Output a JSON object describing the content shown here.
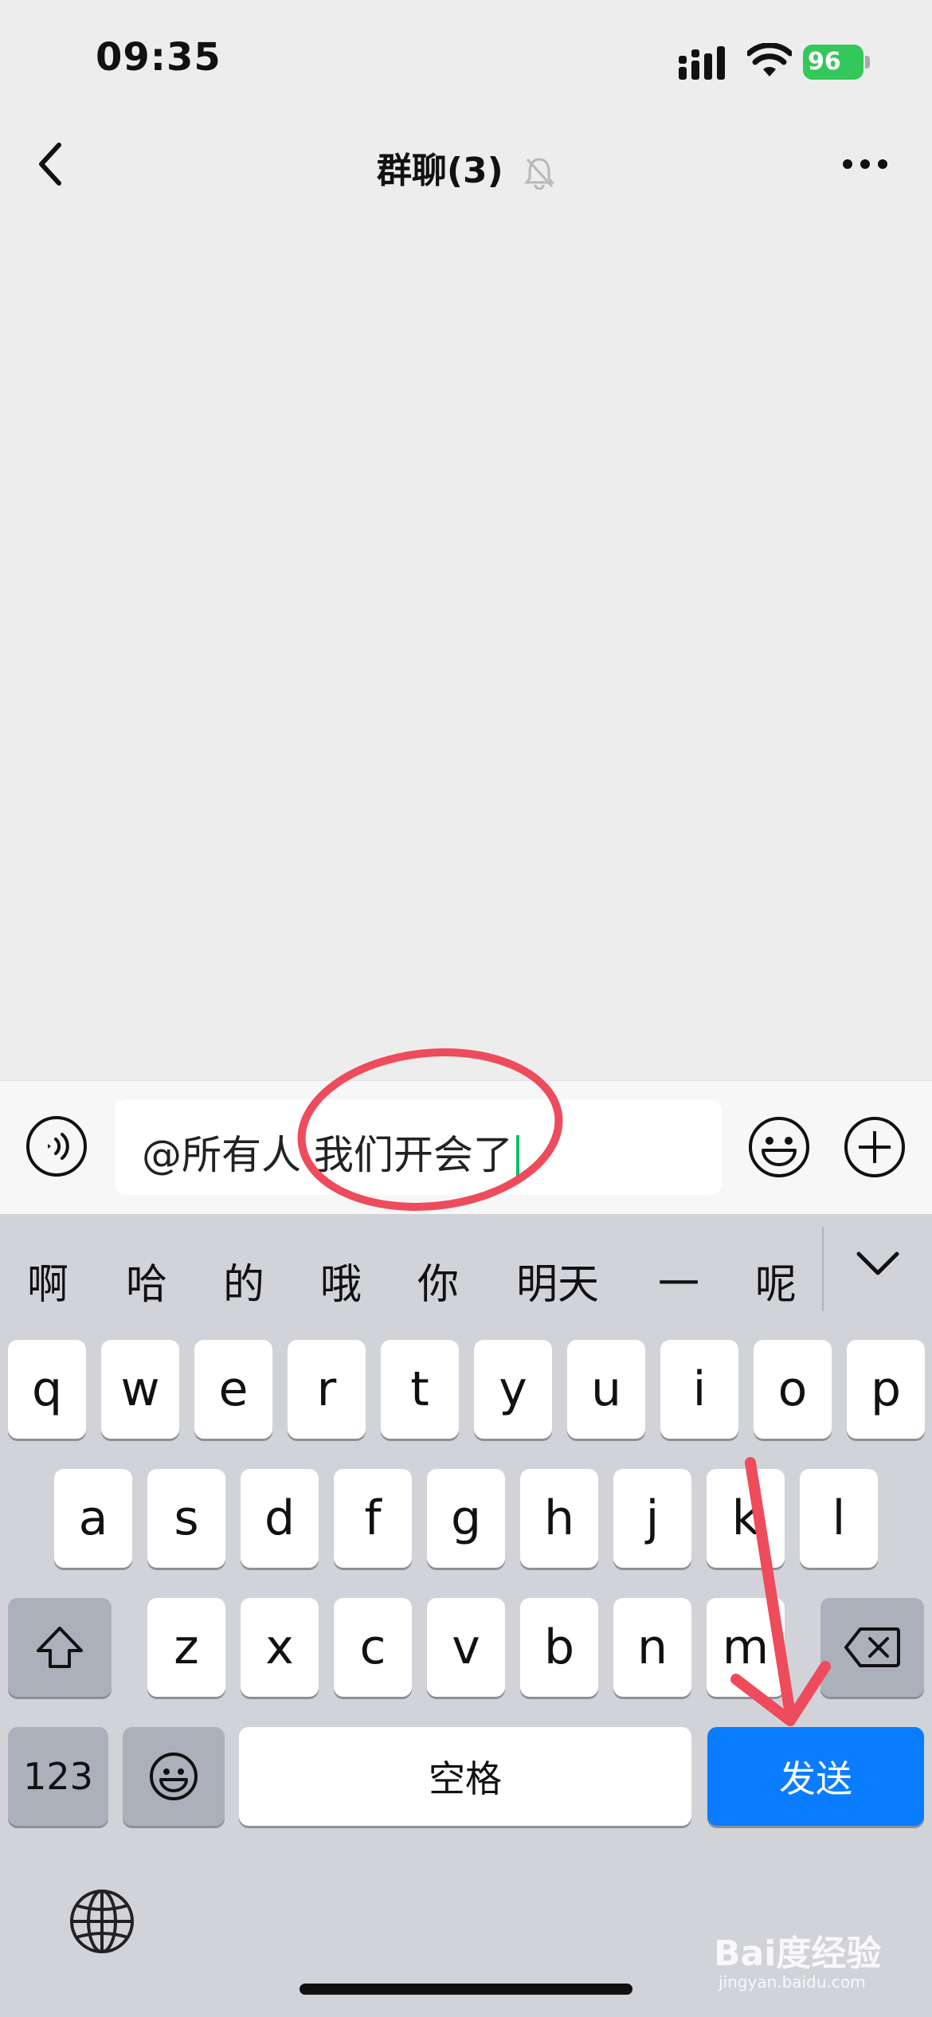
{
  "status_bar": {
    "time": "09:35",
    "battery": "96"
  },
  "nav": {
    "title": "群聊(3)"
  },
  "input": {
    "text": "@所有人 我们开会了"
  },
  "candidates": [
    "啊",
    "哈",
    "的",
    "哦",
    "你",
    "明天",
    "一",
    "呢"
  ],
  "keyboard": {
    "row1": [
      "q",
      "w",
      "e",
      "r",
      "t",
      "y",
      "u",
      "i",
      "o",
      "p"
    ],
    "row2": [
      "a",
      "s",
      "d",
      "f",
      "g",
      "h",
      "j",
      "k",
      "l"
    ],
    "row3": [
      "z",
      "x",
      "c",
      "v",
      "b",
      "n",
      "m"
    ],
    "numbers_label": "123",
    "space_label": "空格",
    "send_label": "发送"
  },
  "watermark": {
    "text": "Bai度经验",
    "sub": "jingyan.baidu.com"
  },
  "colors": {
    "accent_send": "#0a7cff",
    "caret": "#07c160",
    "battery": "#34c759",
    "annotation": "#ee4b5c"
  }
}
